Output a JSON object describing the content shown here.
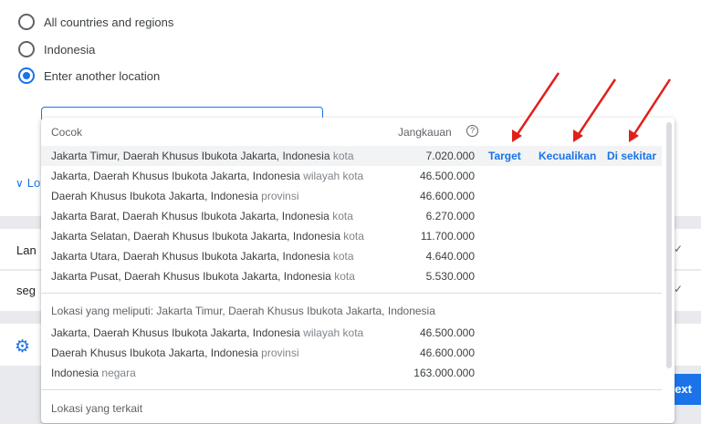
{
  "radio_options": [
    {
      "label": "All countries and regions",
      "checked": false
    },
    {
      "label": "Indonesia",
      "checked": false
    },
    {
      "label": "Enter another location",
      "checked": true
    }
  ],
  "less_link": "Lo",
  "cards": {
    "language_label": "Lan",
    "segment_label": "seg"
  },
  "next_label": "ext",
  "dropdown": {
    "header_match": "Cocok",
    "header_reach": "Jangkauan",
    "matches": [
      {
        "name": "Jakarta Timur, Daerah Khusus Ibukota Jakarta, Indonesia",
        "type": "kota",
        "reach": "7.020.000"
      },
      {
        "name": "Jakarta, Daerah Khusus Ibukota Jakarta, Indonesia",
        "type": "wilayah kota",
        "reach": "46.500.000"
      },
      {
        "name": "Daerah Khusus Ibukota Jakarta, Indonesia",
        "type": "provinsi",
        "reach": "46.600.000"
      },
      {
        "name": "Jakarta Barat, Daerah Khusus Ibukota Jakarta, Indonesia",
        "type": "kota",
        "reach": "6.270.000"
      },
      {
        "name": "Jakarta Selatan, Daerah Khusus Ibukota Jakarta, Indonesia",
        "type": "kota",
        "reach": "11.700.000"
      },
      {
        "name": "Jakarta Utara, Daerah Khusus Ibukota Jakarta, Indonesia",
        "type": "kota",
        "reach": "4.640.000"
      },
      {
        "name": "Jakarta Pusat, Daerah Khusus Ibukota Jakarta, Indonesia",
        "type": "kota",
        "reach": "5.530.000"
      }
    ],
    "actions": {
      "target": "Target",
      "exclude": "Kecualikan",
      "nearby": "Di sekitar"
    },
    "including_title": "Lokasi yang meliputi: Jakarta Timur, Daerah Khusus Ibukota Jakarta, Indonesia",
    "including": [
      {
        "name": "Jakarta, Daerah Khusus Ibukota Jakarta, Indonesia",
        "type": "wilayah kota",
        "reach": "46.500.000"
      },
      {
        "name": "Daerah Khusus Ibukota Jakarta, Indonesia",
        "type": "provinsi",
        "reach": "46.600.000"
      },
      {
        "name": "Indonesia",
        "type": "negara",
        "reach": "163.000.000"
      }
    ],
    "related_title": "Lokasi yang terkait"
  },
  "colors": {
    "accent": "#1a73e8",
    "annotation_arrow": "#e0201b"
  }
}
